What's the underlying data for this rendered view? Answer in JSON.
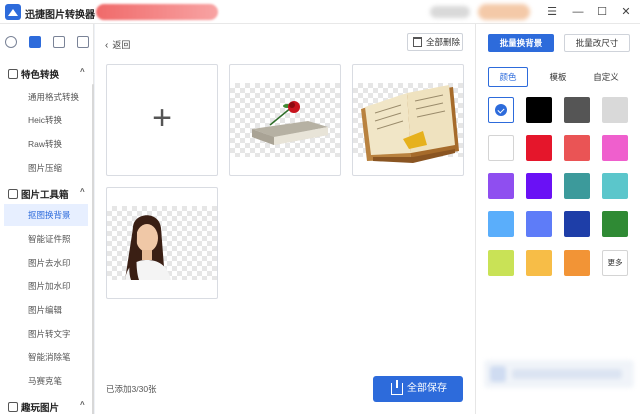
{
  "app": {
    "title": "迅捷图片转换器"
  },
  "sidebar": {
    "section1": {
      "label": "特色转换",
      "items": [
        {
          "label": "通用格式转换"
        },
        {
          "label": "Heic转换"
        },
        {
          "label": "Raw转换"
        },
        {
          "label": "图片压缩"
        }
      ]
    },
    "section2": {
      "label": "图片工具箱",
      "items": [
        {
          "label": "抠图换背景",
          "active": true
        },
        {
          "label": "智能证件照"
        },
        {
          "label": "图片去水印"
        },
        {
          "label": "图片加水印"
        },
        {
          "label": "图片编辑"
        },
        {
          "label": "图片转文字"
        },
        {
          "label": "智能消除笔"
        },
        {
          "label": "马赛克笔"
        }
      ]
    },
    "section3": {
      "label": "趣玩图片"
    }
  },
  "main": {
    "back_label": "返回",
    "delete_all_label": "全部删除",
    "count_label": "已添加3/30张",
    "save_all_label": "全部保存",
    "add_card_symbol": "+"
  },
  "right": {
    "primary_button": "批量换背景",
    "secondary_button": "批量改尺寸",
    "tabs": [
      {
        "label": "颜色",
        "active": true
      },
      {
        "label": "模板"
      },
      {
        "label": "自定义"
      }
    ],
    "swatches": [
      "selected",
      "#000000",
      "#555555",
      "#d9d9d9",
      "#ffffff",
      "#e5162b",
      "#ea5455",
      "#ef5fcd",
      "#8f4ef0",
      "#6a11f5",
      "#3c9a9b",
      "#5bc6cb",
      "#5aaefb",
      "#5e7cf8",
      "#1e3ea8",
      "#2f8a34",
      "#c9e256",
      "#f7bd47",
      "#f29436"
    ],
    "more_label": "更多"
  },
  "colors": {
    "accent": "#2d6bdb",
    "active_bg": "#e7efff"
  }
}
